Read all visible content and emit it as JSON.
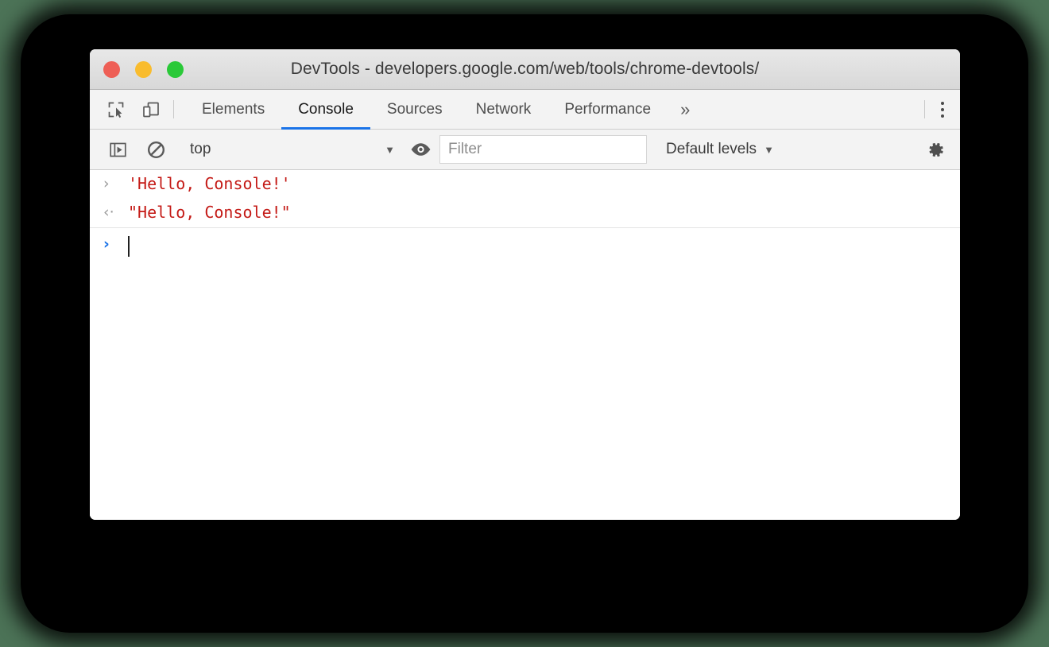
{
  "window": {
    "title": "DevTools - developers.google.com/web/tools/chrome-devtools/",
    "traffic_lights": [
      {
        "name": "close",
        "color": "#ee5f56"
      },
      {
        "name": "minimize",
        "color": "#f9bc2e"
      },
      {
        "name": "zoom",
        "color": "#2ac938"
      }
    ]
  },
  "tabbar": {
    "left_icons": [
      {
        "name": "inspect-element-icon"
      },
      {
        "name": "device-toolbar-icon"
      }
    ],
    "tabs": [
      {
        "label": "Elements",
        "active": false
      },
      {
        "label": "Console",
        "active": true
      },
      {
        "label": "Sources",
        "active": false
      },
      {
        "label": "Network",
        "active": false
      },
      {
        "label": "Performance",
        "active": false
      }
    ],
    "overflow_label": "»",
    "more_menu_name": "more-tools-menu",
    "active_tab_color": "#1a73e8"
  },
  "console_toolbar": {
    "sidebar_toggle_name": "console-sidebar-toggle",
    "clear_console_name": "clear-console-button",
    "context_selector": {
      "value": "top",
      "caret": "▼"
    },
    "live_expression_name": "create-live-expression-button",
    "filter": {
      "value": "",
      "placeholder": "Filter"
    },
    "levels": {
      "label": "Default levels",
      "caret": "▼"
    },
    "settings_name": "devtools-settings-button"
  },
  "console": {
    "lines": [
      {
        "kind": "input",
        "glyph": "›",
        "glyph_style": "gray",
        "text": "'Hello, Console!'"
      },
      {
        "kind": "output",
        "glyph": "‹·",
        "glyph_style": "gray",
        "text": "\"Hello, Console!\""
      }
    ],
    "prompt": {
      "glyph": "›",
      "glyph_style": "blue",
      "value": ""
    },
    "string_color": "#c41a16"
  }
}
